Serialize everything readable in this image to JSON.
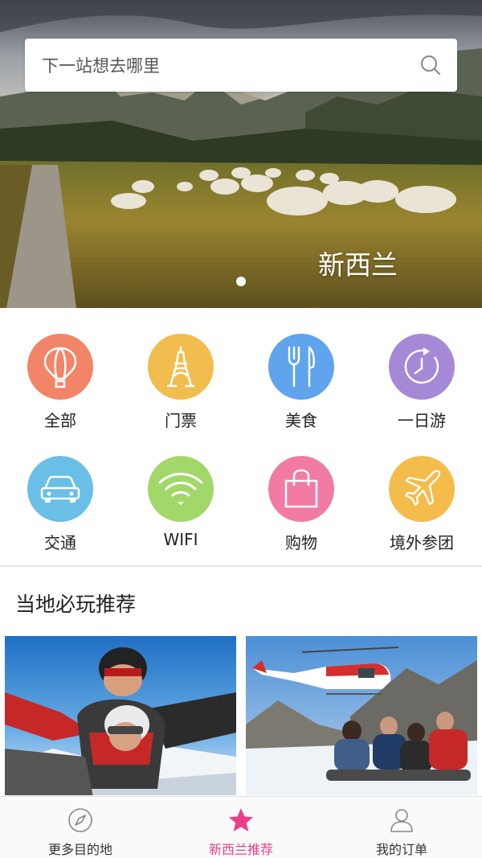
{
  "search": {
    "placeholder": "下一站想去哪里",
    "icon": "search-icon"
  },
  "banner": {
    "caption": "新西兰",
    "page_indicator": {
      "current": 1,
      "total": 1
    }
  },
  "categories": [
    {
      "label": "全部",
      "icon": "hot-air-balloon-icon",
      "color": "#f28567"
    },
    {
      "label": "门票",
      "icon": "eiffel-tower-icon",
      "color": "#f2bd4f"
    },
    {
      "label": "美食",
      "icon": "fork-knife-icon",
      "color": "#5fa4ec"
    },
    {
      "label": "一日游",
      "icon": "clock-refresh-icon",
      "color": "#a689d6"
    },
    {
      "label": "交通",
      "icon": "car-icon",
      "color": "#69bfe6"
    },
    {
      "label": "WIFI",
      "icon": "wifi-icon",
      "color": "#a2d86a"
    },
    {
      "label": "购物",
      "icon": "shopping-bag-icon",
      "color": "#f27ba4"
    },
    {
      "label": "境外参团",
      "icon": "airplane-icon",
      "color": "#f4bc4b"
    }
  ],
  "recommend": {
    "title": "当地必玩推荐"
  },
  "tabbar": {
    "items": [
      {
        "label": "更多目的地",
        "icon": "compass-icon",
        "active": false
      },
      {
        "label": "新西兰推荐",
        "icon": "star-icon",
        "active": true
      },
      {
        "label": "我的订单",
        "icon": "user-icon",
        "active": false
      }
    ],
    "active_color": "#e8418a"
  }
}
